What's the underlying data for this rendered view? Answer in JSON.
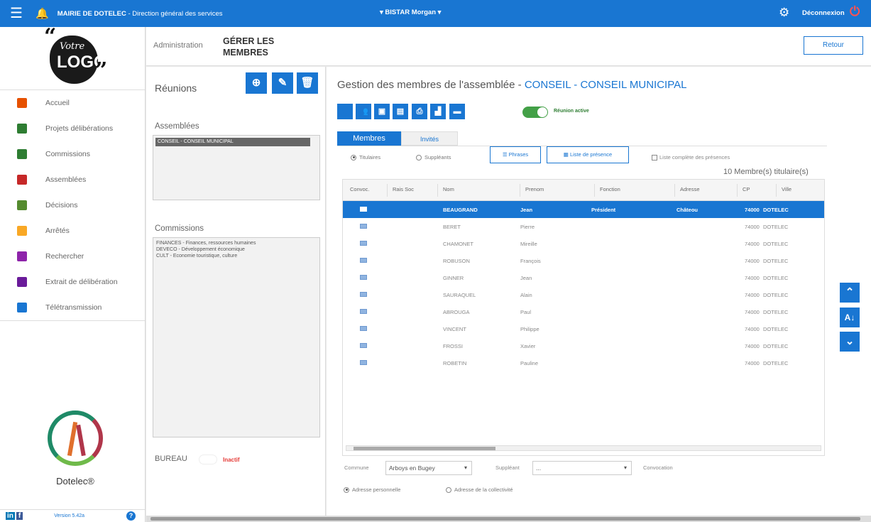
{
  "topbar": {
    "org": "MAIRIE DE DOTELEC",
    "dept": " - Direction général des services",
    "user": "BISTAR Morgan",
    "logout": "Déconnexion"
  },
  "logo": {
    "line1": "Votre",
    "line2": "LOGO"
  },
  "sidebar": {
    "items": [
      {
        "label": "Accueil",
        "icon": "home-icon",
        "color": "#e65100"
      },
      {
        "label": "Projets délibérations",
        "icon": "projects-icon",
        "color": "#2e7d32"
      },
      {
        "label": "Commissions",
        "icon": "commissions-icon",
        "color": "#2e7d32"
      },
      {
        "label": "Assemblées",
        "icon": "assemblies-icon",
        "color": "#c62828"
      },
      {
        "label": "Décisions",
        "icon": "decisions-icon",
        "color": "#558b2f"
      },
      {
        "label": "Arrêtés",
        "icon": "orders-icon",
        "color": "#f9a825"
      },
      {
        "label": "Rechercher",
        "icon": "search-icon",
        "color": "#8e24aa"
      },
      {
        "label": "Extrait de délibération",
        "icon": "extract-icon",
        "color": "#6a1b9a"
      },
      {
        "label": "Télétransmission",
        "icon": "send-icon",
        "color": "#1976d2"
      }
    ]
  },
  "brand": {
    "name": "Dotelec®"
  },
  "footer": {
    "version": "Version 5.42a"
  },
  "header": {
    "crumb": "Administration",
    "title": "GÉRER LES MEMBRES",
    "retour": "Retour"
  },
  "left": {
    "reunions": "Réunions",
    "assemblees_label": "Assemblées",
    "assemblee_selected": "CONSEIL - CONSEIL MUNICIPAL",
    "commissions_label": "Commissions",
    "commissions": [
      "FINANCES - Finances, ressources humaines",
      "DEVECO - Développement économique",
      "CULT - Economie touristique, culture"
    ],
    "bureau": "BUREAU",
    "bureau_status": "Inactif"
  },
  "main": {
    "title_prefix": "Gestion des membres de l'assemblée - ",
    "title_accent": "CONSEIL - CONSEIL MUNICIPAL",
    "toggle_label": "Réunion active",
    "tab_membres": "Membres",
    "tab_invites": "Invités",
    "radio_titulaires": "Titulaires",
    "radio_suppleants": "Suppléants",
    "btn_phrases": "Phrases",
    "btn_liste": "Liste de présence",
    "chk_liste": "Liste complète des présences",
    "count": "10 Membre(s) titulaire(s)",
    "columns": [
      "Convoc.",
      "Rais Soc",
      "Nom",
      "Prenom",
      "Fonction",
      "Adresse",
      "CP",
      "Ville"
    ],
    "rows": [
      {
        "nom": "BEAUGRAND",
        "prenom": "Jean",
        "fonction": "Président",
        "adresse": "Châteou",
        "cp": "74000",
        "ville": "DOTELEC"
      },
      {
        "nom": "BERET",
        "prenom": "Pierre",
        "fonction": "",
        "adresse": "",
        "cp": "74000",
        "ville": "DOTELEC"
      },
      {
        "nom": "CHAMONET",
        "prenom": "Mireille",
        "fonction": "",
        "adresse": "",
        "cp": "74000",
        "ville": "DOTELEC"
      },
      {
        "nom": "ROBUSON",
        "prenom": "François",
        "fonction": "",
        "adresse": "",
        "cp": "74000",
        "ville": "DOTELEC"
      },
      {
        "nom": "GINNER",
        "prenom": "Jean",
        "fonction": "",
        "adresse": "",
        "cp": "74000",
        "ville": "DOTELEC"
      },
      {
        "nom": "SAURAQUEL",
        "prenom": "Alain",
        "fonction": "",
        "adresse": "",
        "cp": "74000",
        "ville": "DOTELEC"
      },
      {
        "nom": "ABROUGA",
        "prenom": "Paul",
        "fonction": "",
        "adresse": "",
        "cp": "74000",
        "ville": "DOTELEC"
      },
      {
        "nom": "VINCENT",
        "prenom": "Philippe",
        "fonction": "",
        "adresse": "",
        "cp": "74000",
        "ville": "DOTELEC"
      },
      {
        "nom": "FROSSI",
        "prenom": "Xavier",
        "fonction": "",
        "adresse": "",
        "cp": "74000",
        "ville": "DOTELEC"
      },
      {
        "nom": "ROBETIN",
        "prenom": "Pauline",
        "fonction": "",
        "adresse": "",
        "cp": "74000",
        "ville": "DOTELEC"
      }
    ],
    "commune_label": "Commune",
    "commune_value": "Arboys en Bugey",
    "suppleant_label": "Suppléant",
    "suppleant_value": "...",
    "convocation_label": "Convocation",
    "adr_perso": "Adresse personnelle",
    "adr_coll": "Adresse de la collectivité"
  },
  "colors": {
    "accent": "#1976d2",
    "active": "#43a047",
    "inactive": "#e53935"
  }
}
